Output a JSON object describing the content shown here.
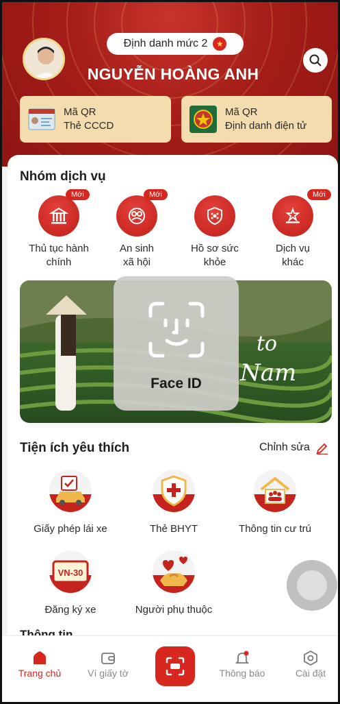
{
  "header": {
    "level_badge": "Định danh mức 2",
    "user_name": "NGUYỄN HOÀNG ANH",
    "qr_cards": [
      {
        "title": "Mã QR",
        "subtitle": "Thẻ CCCD"
      },
      {
        "title": "Mã QR",
        "subtitle": "Định danh điện tử"
      }
    ]
  },
  "services": {
    "title": "Nhóm dịch vụ",
    "badge_new": "Mới",
    "items": [
      {
        "label": "Thủ tục hành chính",
        "icon": "government-building-icon"
      },
      {
        "label": "An sinh xã hội",
        "icon": "social-care-icon"
      },
      {
        "label": "Hồ sơ sức khỏe",
        "icon": "health-shield-icon"
      },
      {
        "label": "Dịch vụ khác",
        "icon": "other-services-icon"
      }
    ]
  },
  "banner": {
    "caption_line1": "to",
    "caption_line2": "Nam",
    "faceid_label": "Face ID"
  },
  "favorites": {
    "title": "Tiện ích yêu thích",
    "edit_label": "Chỉnh sửa",
    "items": [
      {
        "label": "Giấy phép lái xe",
        "icon": "car-license-icon"
      },
      {
        "label": "Thẻ BHYT",
        "icon": "health-insurance-icon"
      },
      {
        "label": "Thông tin cư trú",
        "icon": "residence-icon"
      },
      {
        "label": "Đăng ký xe",
        "icon": "vehicle-plate-icon",
        "plate": "VN-30"
      },
      {
        "label": "Người phụ thuộc",
        "icon": "dependents-icon"
      }
    ]
  },
  "info_title_partial": "Thông tin",
  "nav": {
    "items": [
      {
        "label": "Trang chủ",
        "icon": "home-icon"
      },
      {
        "label": "Ví giấy tờ",
        "icon": "wallet-icon"
      },
      {
        "label": "Thông báo",
        "icon": "bell-icon"
      },
      {
        "label": "Cài đặt",
        "icon": "settings-icon"
      }
    ]
  },
  "colors": {
    "primary": "#d7261e",
    "header_bg": "#a51d19",
    "card_bg": "#f3dcae"
  }
}
